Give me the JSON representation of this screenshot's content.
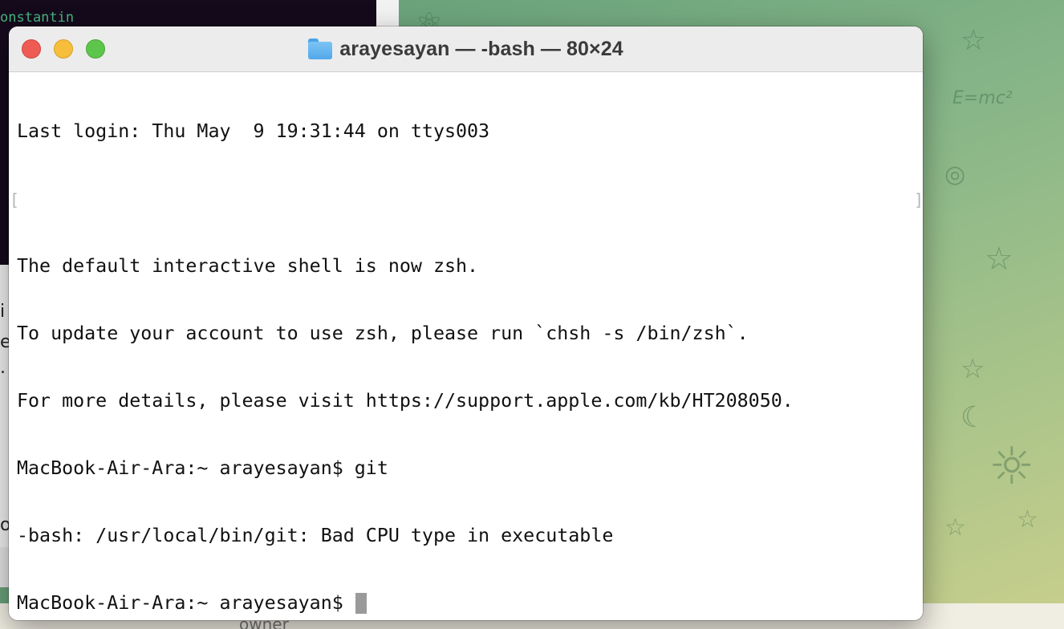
{
  "background": {
    "left_app_text": "onstantin",
    "left_app_fragments": [
      "i",
      "e",
      ".",
      "o"
    ],
    "bottom_text": "owner"
  },
  "terminal": {
    "title": "arayesayan — -bash — 80×24",
    "title_icon": "folder-icon",
    "traffic_lights": {
      "close_color": "#ee5b55",
      "minimize_color": "#f7be3c",
      "zoom_color": "#5ec54c"
    },
    "lines": [
      "Last login: Thu May  9 19:31:44 on ttys003",
      "",
      "The default interactive shell is now zsh.",
      "To update your account to use zsh, please run `chsh -s /bin/zsh`.",
      "For more details, please visit https://support.apple.com/kb/HT208050.",
      "MacBook-Air-Ara:~ arayesayan$ git",
      "-bash: /usr/local/bin/git: Bad CPU type in executable"
    ],
    "prompt": "MacBook-Air-Ara:~ arayesayan$ ",
    "mark_left": "[",
    "mark_right": "]"
  }
}
